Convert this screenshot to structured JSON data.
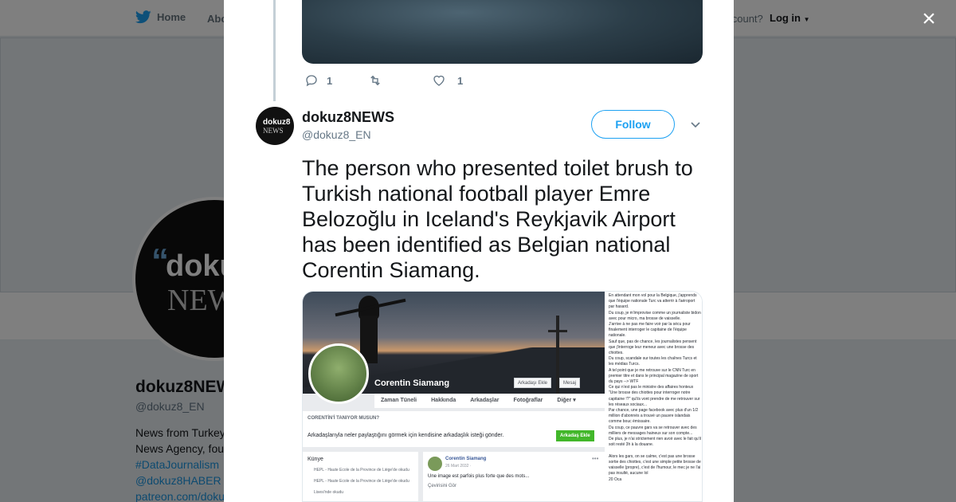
{
  "background_page": {
    "nav": {
      "home_label": "Home",
      "about_label": "Abo",
      "account_text": "account?",
      "login_label": "Log in"
    },
    "avatar": {
      "logo_top": "dokuz",
      "logo_bottom": "NEWS"
    },
    "profile": {
      "name": "dokuz8NEW",
      "handle": "@dokuz8_EN",
      "bio_line1": "News from Turkey",
      "bio_line2": "News Agency, fou",
      "hashtag": "#DataJournalism",
      "mention": "@dokuz8HABER",
      "link": "patreon.com/doku"
    }
  },
  "modal": {
    "close_label": "×",
    "previous_tweet": {
      "reply_count": "1",
      "retweet_count": "",
      "like_count": "1"
    },
    "tweet": {
      "avatar": {
        "logo_top": "dokuz8",
        "logo_bottom": "NEWS"
      },
      "author_name": "dokuz8NEWS",
      "author_handle": "@dokuz8_EN",
      "follow_label": "Follow",
      "text": "The person who presented toilet brush to Turkish national football player Emre Belozoğlu in Iceland's Reykjavik Airport has been identified as Belgian national Corentin Siamang.",
      "media": {
        "profile_name": "Corentin Siamang",
        "button_add_friend": "Arkadaşı Ekle",
        "button_message": "Mesaj",
        "tabs": [
          "Zaman Tüneli",
          "Hakkında",
          "Arkadaşlar",
          "Fotoğraflar",
          "Diğer ▾"
        ],
        "know_question": "CORENTİN'İ TANIYOR MUSUN?",
        "know_prompt": "Arkadaşlarıyla neler paylaştığını görmek için kendisine arkadaşlık isteği gönder.",
        "add_friend_cta": "Arkadaş Ekle",
        "intro_heading": "Künye",
        "intro_items": [
          "HEPL - Haute Ecole de la Province de Liège'de okudu",
          "HEPL - Haute Ecole de la Province de Liège'de okudu",
          "Lisesi'nde okudu"
        ],
        "post_author": "Corentin Siamang",
        "post_meta": "26 Mart 2032 · ",
        "post_text": "Une image est parfois plus forte que des mots...",
        "post_translate": "Çevirisini Gör",
        "note_text": "En attendant mon vol pour la Belgique, j'apprends que l'équipe nationale Turc va atterrir à l'aéroport par hasard.\nDu coup, je m'improvise comme un journaliste bidon avec pour micro, ma brosse de vaisselle.\nJ'arrive à ne pas me faire voir par la sécu pour finalement interroger le capitaine de l'équipe nationale.\nSauf que, pas de chance, les journalistes pensent que j'interroge leur meneur avec une brosse des chiottes.\nDu coup, scandale sur toutes les chaînes Turcs et les médias Turcs.\nA tel point que je me retrouve sur le CNN Turc en premier titre et dans le principal magazine de sport du pays --> WTF\nCe qui n'est pas le ministre des affaires honteux \"Une brosse des chiottes pour interroger notre capitaine !?\" qu'ils vont prendre de me retrouver sur les réseaux sociaux...\nPar chance, une page facebook avec plus d'un 1/2 million d'abonnés a trouvé un pauvre islandais comme bouc émissaire.\nDu coup, ce pauvre gars va se retrouver avec des milliers de messages haineux sur son compte...\nDe plus, je n'ai strictement rien avoir avec le fait qu'il soit resté 3h à la douane.\n\nAlors les gars, on se calme, c'est pas une brosse sortie des chiottes, c'est une simple petite brosse de vaisselle (propre), c'est de l'humour, le mec je ne l'ai pas insulté, aucune lol\n20 Oca"
      }
    }
  }
}
